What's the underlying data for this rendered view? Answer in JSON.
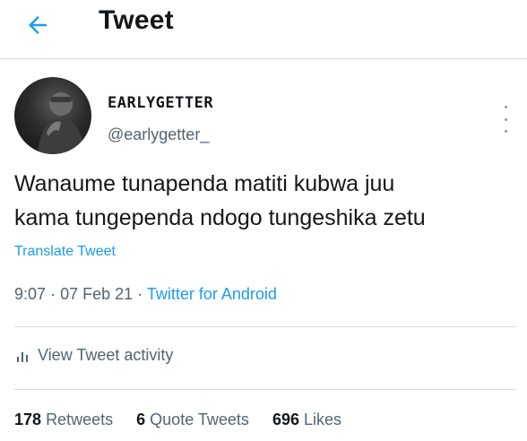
{
  "header": {
    "title": "Tweet",
    "back_icon": "arrow-left-icon"
  },
  "colors": {
    "accent": "#1d9bf0",
    "muted": "#536471",
    "text": "#14171a",
    "divider": "#d9dde0"
  },
  "author": {
    "display_name": "EARLYGETTER",
    "handle": "@earlygetter_"
  },
  "tweet": {
    "lines": [
      "Wanaume tunapenda matiti kubwa juu",
      "kama tungependa ndogo tungeshika zetu"
    ],
    "translate_label": "Translate Tweet",
    "time": "9:07",
    "date": "07 Feb 21",
    "source": "Twitter for Android",
    "separator": "·"
  },
  "activity": {
    "label": "View Tweet activity",
    "icon": "bar-chart-icon"
  },
  "stats": {
    "retweets": {
      "count": "178",
      "label": "Retweets"
    },
    "quotes": {
      "count": "6",
      "label": "Quote Tweets"
    },
    "likes": {
      "count": "696",
      "label": "Likes"
    }
  }
}
